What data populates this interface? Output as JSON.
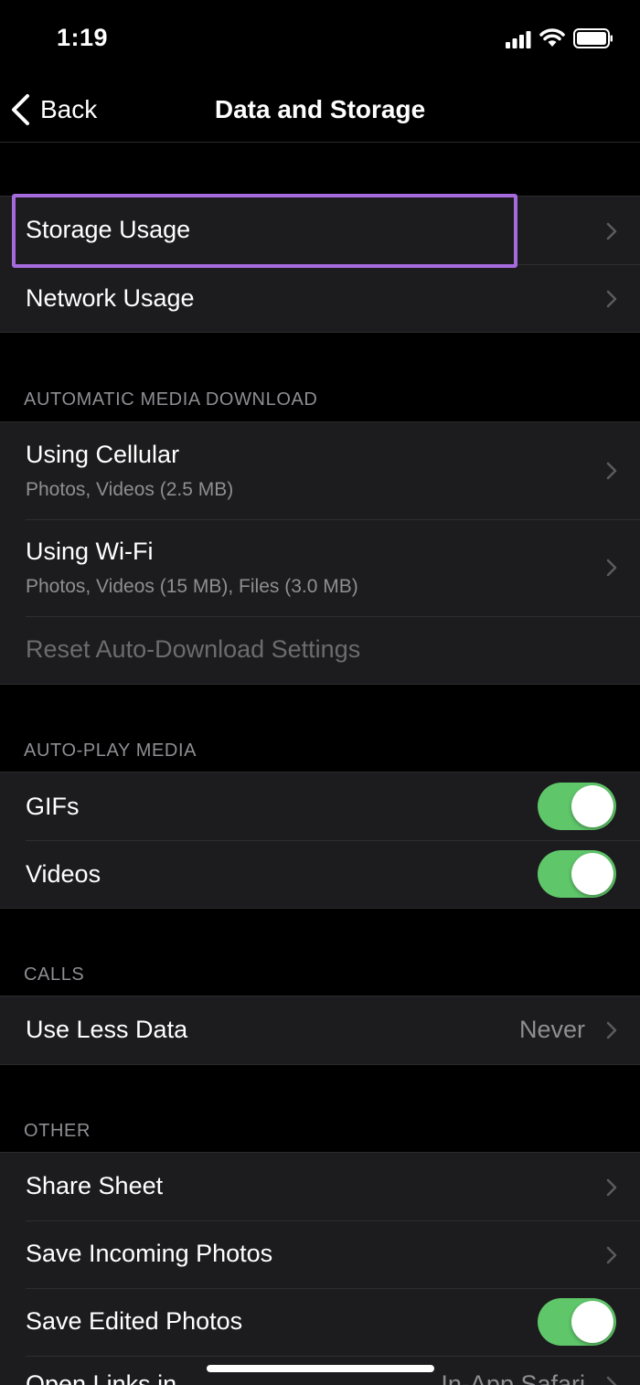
{
  "status": {
    "time": "1:19"
  },
  "nav": {
    "back_label": "Back",
    "title": "Data and Storage"
  },
  "usage": {
    "storage_label": "Storage Usage",
    "network_label": "Network Usage"
  },
  "auto_download": {
    "header": "AUTOMATIC MEDIA DOWNLOAD",
    "cellular_label": "Using Cellular",
    "cellular_sub": "Photos, Videos (2.5 MB)",
    "wifi_label": "Using Wi-Fi",
    "wifi_sub": "Photos, Videos (15 MB), Files (3.0 MB)",
    "reset_label": "Reset Auto-Download Settings"
  },
  "auto_play": {
    "header": "AUTO-PLAY MEDIA",
    "gifs_label": "GIFs",
    "gifs_on": true,
    "videos_label": "Videos",
    "videos_on": true
  },
  "calls": {
    "header": "CALLS",
    "less_data_label": "Use Less Data",
    "less_data_value": "Never"
  },
  "other": {
    "header": "OTHER",
    "share_sheet_label": "Share Sheet",
    "save_incoming_label": "Save Incoming Photos",
    "save_edited_label": "Save Edited Photos",
    "save_edited_on": true,
    "open_links_label": "Open Links in",
    "open_links_value": "In-App Safari"
  },
  "colors": {
    "background": "#000000",
    "cell": "#1c1c1e",
    "toggle_on": "#5fc66a",
    "highlight": "#a56bdc",
    "secondary_text": "#8e8e93"
  }
}
